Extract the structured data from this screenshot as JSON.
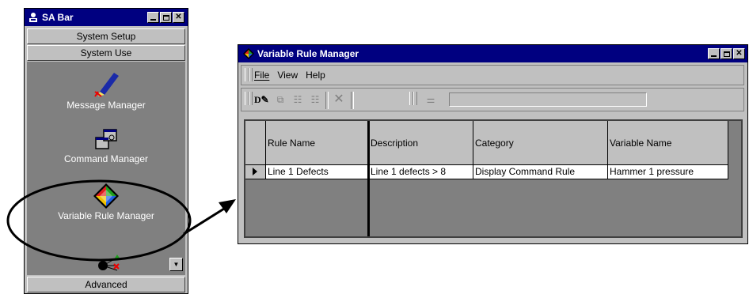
{
  "sabar": {
    "title": "SA Bar",
    "groups": {
      "system_setup": "System Setup",
      "system_use": "System Use",
      "advanced": "Advanced"
    },
    "tools": [
      {
        "label": "Message Manager",
        "icon": "pen-icon"
      },
      {
        "label": "Command Manager",
        "icon": "command-windows-icon"
      },
      {
        "label": "Variable Rule Manager",
        "icon": "diamond-rule-icon"
      }
    ]
  },
  "vrm": {
    "title": "Variable Rule Manager",
    "menu": {
      "file": "File",
      "view": "View",
      "help": "Help"
    },
    "columns": [
      "Rule Name",
      "Description",
      "Category",
      "Variable Name"
    ],
    "rows": [
      [
        "Line 1 Defects",
        "Line  1 defects > 8",
        "Display Command Rule",
        "Hammer 1 pressure"
      ]
    ],
    "toolbar_icons": [
      "new-rule-icon",
      "copy-icon",
      "properties-icon",
      "properties-alt-icon",
      "delete-icon",
      "filter-icon"
    ]
  },
  "colors": {
    "titlebar": "#000080",
    "face": "#c0c0c0",
    "panel": "#808080"
  }
}
